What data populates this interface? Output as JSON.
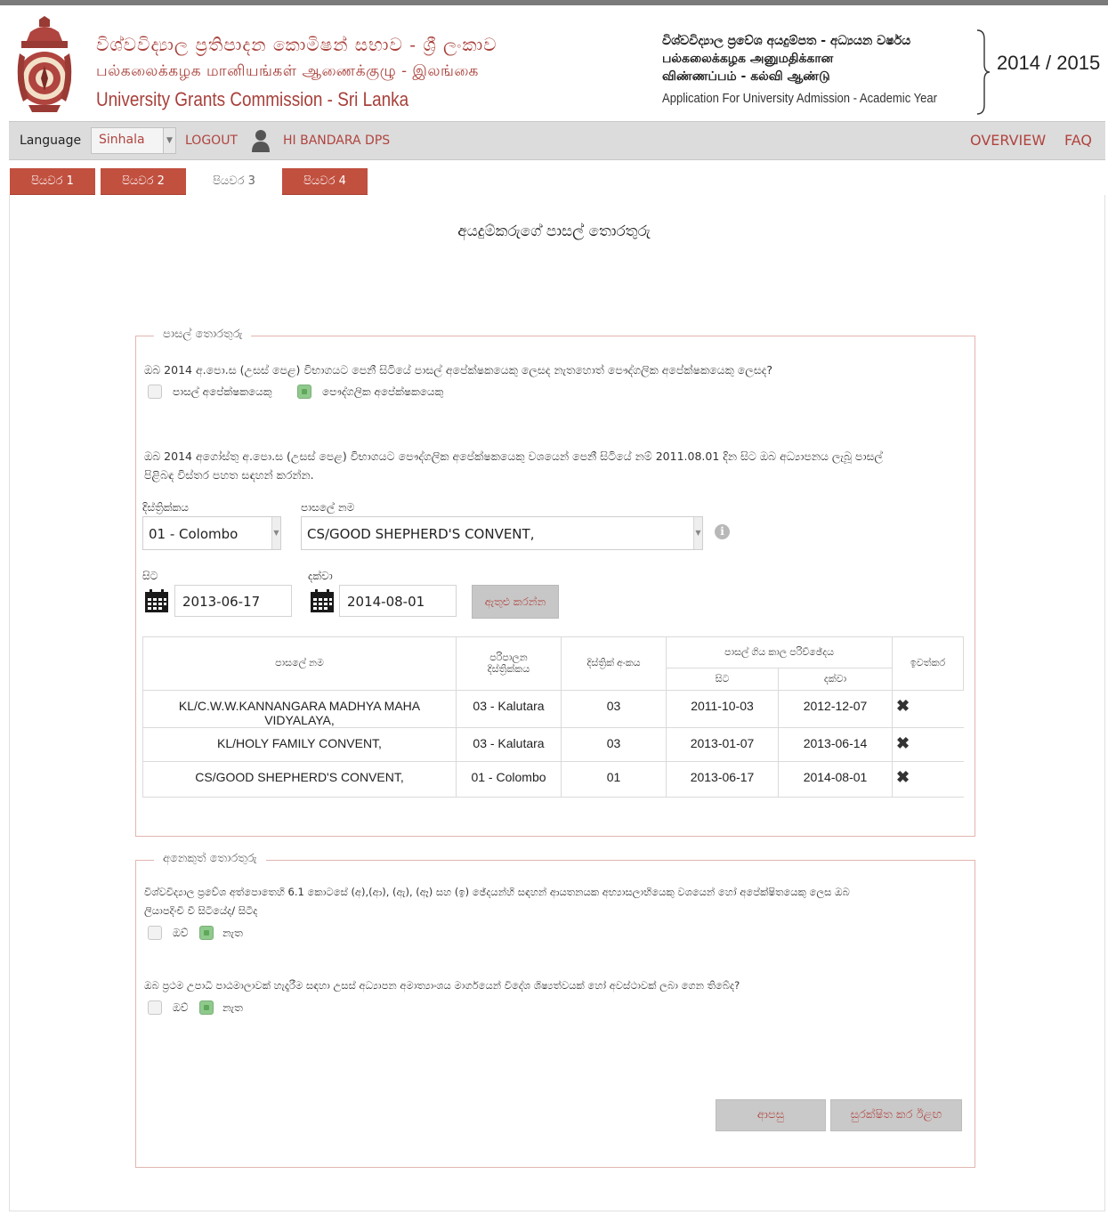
{
  "header": {
    "title_si": "විශ්වවිද්‍යාල ප්‍රතිපාදන කොමිෂන් සභාව - ශ්‍රී ලංකාව",
    "title_ta": "பல்கலைக்கழக மானியங்கள் ஆணைக்குழு - இலங்கை",
    "title_en": "University Grants Commission - Sri Lanka",
    "app_si": "විශ්වවිද්‍යාල ප්‍රවේශ අයදුම්පත - අධ්‍යයන වර්ෂය",
    "app_ta_1": "பல்கலைக்கழக அனுமதிக்கான",
    "app_ta_2": "விண்ணப்பம் - கல்வி ஆண்டு",
    "app_en": "Application For University Admission - Academic Year",
    "year": "2014 / 2015"
  },
  "navbar": {
    "language_label": "Language",
    "language_value": "Sinhala",
    "logout": "LOGOUT",
    "username": "HI BANDARA DPS",
    "overview": "OVERVIEW",
    "faq": "FAQ"
  },
  "tabs": [
    {
      "label": "පියවර 1"
    },
    {
      "label": "පියවර 2"
    },
    {
      "label": "පියවර 3"
    },
    {
      "label": "පියවර 4"
    }
  ],
  "page_title": "අයදුම්කරුගේ පාසල් තොරතුරු",
  "school_section": {
    "legend": "පාසල් තොරතුරු",
    "q1": "ඔබ 2014 අ.පො.ස (උසස් පෙළ) විභාගයට පෙනී සිටියේ පාසල් අපේක්ෂකයෙකු ලෙසද නැතහොත් පෞද්ගලික අපේක්ෂකයෙකු ලෙසද?",
    "opt_school": "පාසල් අපේක්ෂකයෙකු",
    "opt_private": "පෞද්ගලික අපේක්ෂකයෙකු",
    "q2_line1": "ඔබ 2014 අගෝස්තු අ.පො.ස (උසස් පෙළ) විභාගයට පෞද්ගලික අපේක්ෂකයෙකු වශයෙන් පෙනී සිටියේ නම් 2011.08.01 දින සිට ඔබ අධ්‍යාපනය ලැබූ පාසල්",
    "q2_line2": "පිළිබඳ විස්තර පහත සඳහන් කරන්න.",
    "district_label": "දිස්ත්‍රික්කය",
    "district_value": "01 - Colombo",
    "school_label": "පාසලේ නම",
    "school_value": "CS/GOOD SHEPHERD'S CONVENT,",
    "from_label": "සිට",
    "from_value": "2013-06-17",
    "to_label": "දක්වා",
    "to_value": "2014-08-01",
    "add_button": "ඇතුළු කරන්න"
  },
  "table": {
    "headers": {
      "school_name": "පාසලේ නම",
      "admin_district_1": "පරිපාලන",
      "admin_district_2": "දිස්ත්‍රික්කය",
      "district_no": "දිස්ත්‍රික් අංකය",
      "period": "පාසල් ගිය කාල පරිච්ඡේදය",
      "from": "සිට",
      "to": "දක්වා",
      "remove": "ඉවත්කර"
    },
    "rows": [
      {
        "school": "KL/C.W.W.KANNANGARA MADHYA MAHA VIDYALAYA,",
        "district": "03 - Kalutara",
        "no": "03",
        "from": "2011-10-03",
        "to": "2012-12-07"
      },
      {
        "school": "KL/HOLY FAMILY CONVENT,",
        "district": "03 - Kalutara",
        "no": "03",
        "from": "2013-01-07",
        "to": "2013-06-14"
      },
      {
        "school": "CS/GOOD SHEPHERD'S CONVENT,",
        "district": "01 - Colombo",
        "no": "01",
        "from": "2013-06-17",
        "to": "2014-08-01"
      }
    ],
    "delete_glyph": "✖"
  },
  "other_section": {
    "legend": "අනෙකුත් තොරතුරු",
    "q1_line1": "විශ්වවිද්‍යාල ප්‍රවේශ අත්පොතෙහි 6.1 කොටසේ (අ),(ආ), (ඇ), (ඈ) සහ (ඉ) ඡේදයන්හි සඳහන් ආයතනයක අභ්‍යාසලාභියෙකු වශයෙන් හෝ අපේක්ෂිතයෙකු ලෙස ඔබ",
    "q1_line2": "ලියාපදිංචි වී සිටියේද/ සිටීද",
    "q2": "ඔබ ප්‍රථම උපාධි පාඨමාලාවක් හැදෑරීම සඳහා උසස් අධ්‍යාපන අමාත්‍යාංශය මාර්ගයෙන් විදේශ ශිෂ්‍යත්වයක් හෝ අවස්ථාවක් ලබා ගෙන තිබේද?",
    "yes": "ඔව්",
    "no": "නැත"
  },
  "buttons": {
    "back": "ආපසු",
    "save_next": "සුරක්ෂිත කර ඊළඟ"
  },
  "colors": {
    "brand": "#a8403a",
    "tab_active": "#c1503f",
    "checkbox_checked": "#8fc98c"
  }
}
